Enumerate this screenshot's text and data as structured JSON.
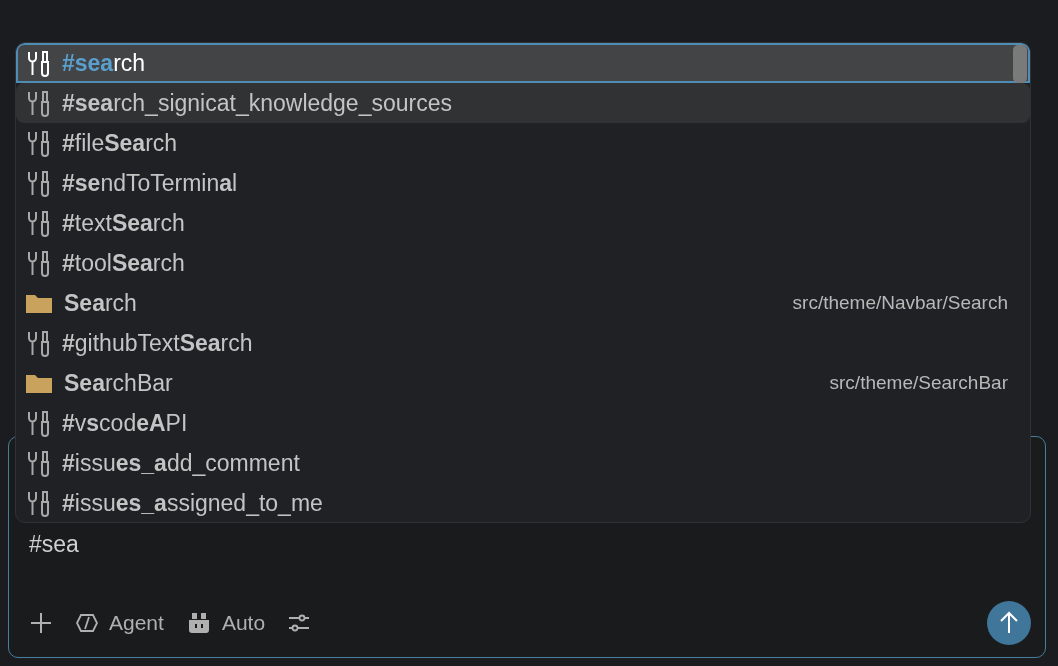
{
  "suggestions": [
    {
      "kind": "tool",
      "label": "**#sea**rch",
      "selected": true,
      "hovered": false
    },
    {
      "kind": "tool",
      "label": "**#sea**rch_signicat_knowledge_sources",
      "selected": false,
      "hovered": true
    },
    {
      "kind": "tool",
      "label": "**#**file**Sea**rch",
      "selected": false,
      "hovered": false
    },
    {
      "kind": "tool",
      "label": "**#se**ndToTermin**a**l",
      "selected": false,
      "hovered": false
    },
    {
      "kind": "tool",
      "label": "**#**text**Sea**rch",
      "selected": false,
      "hovered": false
    },
    {
      "kind": "tool",
      "label": "**#**tool**Sea**rch",
      "selected": false,
      "hovered": false
    },
    {
      "kind": "folder",
      "label": "**Sea**rch",
      "path": "src/theme/Navbar/Search",
      "selected": false,
      "hovered": false
    },
    {
      "kind": "tool",
      "label": "**#**githubText**Sea**rch",
      "selected": false,
      "hovered": false
    },
    {
      "kind": "folder",
      "label": "**Sea**rchBar",
      "path": "src/theme/SearchBar",
      "selected": false,
      "hovered": false
    },
    {
      "kind": "tool",
      "label": "**#**v**s**cod**eA**PI",
      "selected": false,
      "hovered": false
    },
    {
      "kind": "tool",
      "label": "**#**issu**es_a**dd_comment",
      "selected": false,
      "hovered": false
    },
    {
      "kind": "tool",
      "label": "**#**issu**es_a**ssigned_to_me",
      "selected": false,
      "hovered": false
    }
  ],
  "input": {
    "value": "#sea"
  },
  "toolbar": {
    "mode": "Agent",
    "model": "Auto"
  }
}
